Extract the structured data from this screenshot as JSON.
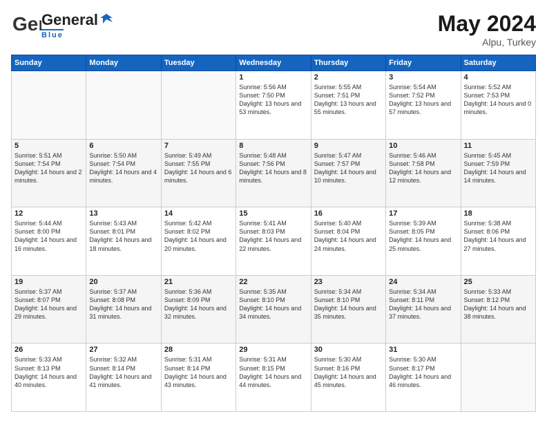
{
  "header": {
    "logo_general": "General",
    "logo_blue": "Blue",
    "month_title": "May 2024",
    "subtitle": "Alpu, Turkey"
  },
  "weekdays": [
    "Sunday",
    "Monday",
    "Tuesday",
    "Wednesday",
    "Thursday",
    "Friday",
    "Saturday"
  ],
  "weeks": [
    [
      {
        "day": "",
        "sunrise": "",
        "sunset": "",
        "daylight": ""
      },
      {
        "day": "",
        "sunrise": "",
        "sunset": "",
        "daylight": ""
      },
      {
        "day": "",
        "sunrise": "",
        "sunset": "",
        "daylight": ""
      },
      {
        "day": "1",
        "sunrise": "Sunrise: 5:56 AM",
        "sunset": "Sunset: 7:50 PM",
        "daylight": "Daylight: 13 hours and 53 minutes."
      },
      {
        "day": "2",
        "sunrise": "Sunrise: 5:55 AM",
        "sunset": "Sunset: 7:51 PM",
        "daylight": "Daylight: 13 hours and 55 minutes."
      },
      {
        "day": "3",
        "sunrise": "Sunrise: 5:54 AM",
        "sunset": "Sunset: 7:52 PM",
        "daylight": "Daylight: 13 hours and 57 minutes."
      },
      {
        "day": "4",
        "sunrise": "Sunrise: 5:52 AM",
        "sunset": "Sunset: 7:53 PM",
        "daylight": "Daylight: 14 hours and 0 minutes."
      }
    ],
    [
      {
        "day": "5",
        "sunrise": "Sunrise: 5:51 AM",
        "sunset": "Sunset: 7:54 PM",
        "daylight": "Daylight: 14 hours and 2 minutes."
      },
      {
        "day": "6",
        "sunrise": "Sunrise: 5:50 AM",
        "sunset": "Sunset: 7:54 PM",
        "daylight": "Daylight: 14 hours and 4 minutes."
      },
      {
        "day": "7",
        "sunrise": "Sunrise: 5:49 AM",
        "sunset": "Sunset: 7:55 PM",
        "daylight": "Daylight: 14 hours and 6 minutes."
      },
      {
        "day": "8",
        "sunrise": "Sunrise: 5:48 AM",
        "sunset": "Sunset: 7:56 PM",
        "daylight": "Daylight: 14 hours and 8 minutes."
      },
      {
        "day": "9",
        "sunrise": "Sunrise: 5:47 AM",
        "sunset": "Sunset: 7:57 PM",
        "daylight": "Daylight: 14 hours and 10 minutes."
      },
      {
        "day": "10",
        "sunrise": "Sunrise: 5:46 AM",
        "sunset": "Sunset: 7:58 PM",
        "daylight": "Daylight: 14 hours and 12 minutes."
      },
      {
        "day": "11",
        "sunrise": "Sunrise: 5:45 AM",
        "sunset": "Sunset: 7:59 PM",
        "daylight": "Daylight: 14 hours and 14 minutes."
      }
    ],
    [
      {
        "day": "12",
        "sunrise": "Sunrise: 5:44 AM",
        "sunset": "Sunset: 8:00 PM",
        "daylight": "Daylight: 14 hours and 16 minutes."
      },
      {
        "day": "13",
        "sunrise": "Sunrise: 5:43 AM",
        "sunset": "Sunset: 8:01 PM",
        "daylight": "Daylight: 14 hours and 18 minutes."
      },
      {
        "day": "14",
        "sunrise": "Sunrise: 5:42 AM",
        "sunset": "Sunset: 8:02 PM",
        "daylight": "Daylight: 14 hours and 20 minutes."
      },
      {
        "day": "15",
        "sunrise": "Sunrise: 5:41 AM",
        "sunset": "Sunset: 8:03 PM",
        "daylight": "Daylight: 14 hours and 22 minutes."
      },
      {
        "day": "16",
        "sunrise": "Sunrise: 5:40 AM",
        "sunset": "Sunset: 8:04 PM",
        "daylight": "Daylight: 14 hours and 24 minutes."
      },
      {
        "day": "17",
        "sunrise": "Sunrise: 5:39 AM",
        "sunset": "Sunset: 8:05 PM",
        "daylight": "Daylight: 14 hours and 25 minutes."
      },
      {
        "day": "18",
        "sunrise": "Sunrise: 5:38 AM",
        "sunset": "Sunset: 8:06 PM",
        "daylight": "Daylight: 14 hours and 27 minutes."
      }
    ],
    [
      {
        "day": "19",
        "sunrise": "Sunrise: 5:37 AM",
        "sunset": "Sunset: 8:07 PM",
        "daylight": "Daylight: 14 hours and 29 minutes."
      },
      {
        "day": "20",
        "sunrise": "Sunrise: 5:37 AM",
        "sunset": "Sunset: 8:08 PM",
        "daylight": "Daylight: 14 hours and 31 minutes."
      },
      {
        "day": "21",
        "sunrise": "Sunrise: 5:36 AM",
        "sunset": "Sunset: 8:09 PM",
        "daylight": "Daylight: 14 hours and 32 minutes."
      },
      {
        "day": "22",
        "sunrise": "Sunrise: 5:35 AM",
        "sunset": "Sunset: 8:10 PM",
        "daylight": "Daylight: 14 hours and 34 minutes."
      },
      {
        "day": "23",
        "sunrise": "Sunrise: 5:34 AM",
        "sunset": "Sunset: 8:10 PM",
        "daylight": "Daylight: 14 hours and 35 minutes."
      },
      {
        "day": "24",
        "sunrise": "Sunrise: 5:34 AM",
        "sunset": "Sunset: 8:11 PM",
        "daylight": "Daylight: 14 hours and 37 minutes."
      },
      {
        "day": "25",
        "sunrise": "Sunrise: 5:33 AM",
        "sunset": "Sunset: 8:12 PM",
        "daylight": "Daylight: 14 hours and 38 minutes."
      }
    ],
    [
      {
        "day": "26",
        "sunrise": "Sunrise: 5:33 AM",
        "sunset": "Sunset: 8:13 PM",
        "daylight": "Daylight: 14 hours and 40 minutes."
      },
      {
        "day": "27",
        "sunrise": "Sunrise: 5:32 AM",
        "sunset": "Sunset: 8:14 PM",
        "daylight": "Daylight: 14 hours and 41 minutes."
      },
      {
        "day": "28",
        "sunrise": "Sunrise: 5:31 AM",
        "sunset": "Sunset: 8:14 PM",
        "daylight": "Daylight: 14 hours and 43 minutes."
      },
      {
        "day": "29",
        "sunrise": "Sunrise: 5:31 AM",
        "sunset": "Sunset: 8:15 PM",
        "daylight": "Daylight: 14 hours and 44 minutes."
      },
      {
        "day": "30",
        "sunrise": "Sunrise: 5:30 AM",
        "sunset": "Sunset: 8:16 PM",
        "daylight": "Daylight: 14 hours and 45 minutes."
      },
      {
        "day": "31",
        "sunrise": "Sunrise: 5:30 AM",
        "sunset": "Sunset: 8:17 PM",
        "daylight": "Daylight: 14 hours and 46 minutes."
      },
      {
        "day": "",
        "sunrise": "",
        "sunset": "",
        "daylight": ""
      }
    ]
  ]
}
